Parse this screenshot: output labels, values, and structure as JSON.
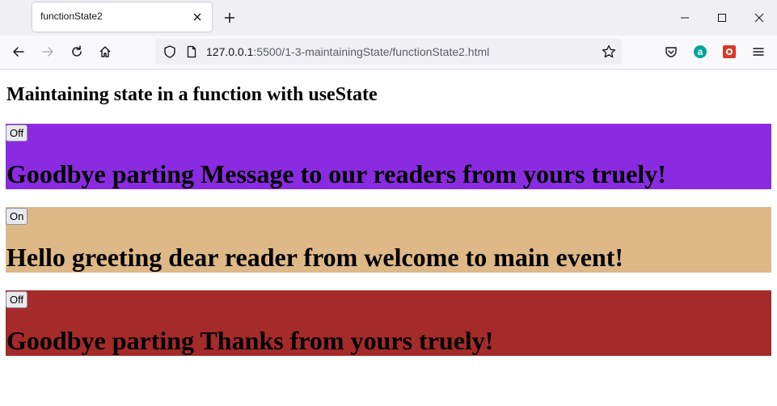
{
  "browser": {
    "tab_title": "functionState2",
    "url_host": "127.0.0.1",
    "url_rest": ":5500/1-3-maintainingState/functionState2.html"
  },
  "page": {
    "title": "Maintaining state in a function with useState",
    "panels": [
      {
        "button": "Off",
        "message": "Goodbye parting Message to our readers from yours truely!",
        "color": "#8a2be2"
      },
      {
        "button": "On",
        "message": "Hello greeting dear reader from welcome to main event!",
        "color": "#deb887"
      },
      {
        "button": "Off",
        "message": "Goodbye parting Thanks from yours truely!",
        "color": "#a52a2a"
      }
    ]
  }
}
